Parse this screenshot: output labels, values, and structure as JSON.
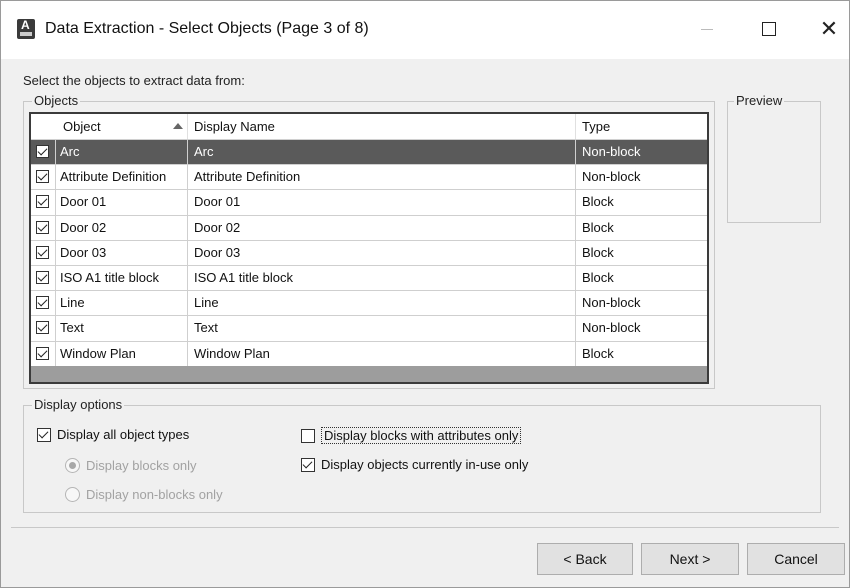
{
  "window": {
    "title": "Data Extraction - Select Objects (Page 3 of 8)",
    "controls": {
      "minimize": "—",
      "maximize": "☐",
      "close": "✕"
    }
  },
  "prompt": "Select the objects to extract data from:",
  "objects_group": {
    "label": "Objects",
    "columns": {
      "object": "Object",
      "display_name": "Display Name",
      "type": "Type"
    },
    "sort_column": "Object",
    "sort_direction": "ascending",
    "rows": [
      {
        "checked": true,
        "object": "Arc",
        "display_name": "Arc",
        "type": "Non-block",
        "selected": true
      },
      {
        "checked": true,
        "object": "Attribute Definition",
        "display_name": "Attribute Definition",
        "type": "Non-block"
      },
      {
        "checked": true,
        "object": "Door 01",
        "display_name": "Door 01",
        "type": "Block"
      },
      {
        "checked": true,
        "object": "Door 02",
        "display_name": "Door 02",
        "type": "Block"
      },
      {
        "checked": true,
        "object": "Door 03",
        "display_name": "Door 03",
        "type": "Block"
      },
      {
        "checked": true,
        "object": "ISO A1 title block",
        "display_name": "ISO A1 title block",
        "type": "Block"
      },
      {
        "checked": true,
        "object": "Line",
        "display_name": "Line",
        "type": "Non-block"
      },
      {
        "checked": true,
        "object": "Text",
        "display_name": "Text",
        "type": "Non-block"
      },
      {
        "checked": true,
        "object": "Window Plan",
        "display_name": "Window Plan",
        "type": "Block"
      }
    ]
  },
  "preview_group": {
    "label": "Preview"
  },
  "display_options": {
    "label": "Display options",
    "display_all_object_types": {
      "label": "Display all object types",
      "checked": true
    },
    "display_blocks_only": {
      "label": "Display blocks only",
      "selected": true,
      "disabled": true
    },
    "display_non_blocks_only": {
      "label": "Display non-blocks only",
      "selected": false,
      "disabled": true
    },
    "display_blocks_with_attributes_only": {
      "label": "Display blocks with attributes only",
      "checked": false
    },
    "display_objects_in_use_only": {
      "label": "Display objects currently in-use only",
      "checked": true
    }
  },
  "buttons": {
    "back": "< Back",
    "next": "Next >",
    "cancel": "Cancel"
  },
  "colors": {
    "selected_row": "#5a5a5a",
    "list_border": "#3b3b3b",
    "dialog_bg": "#f0f0f0",
    "button_bg": "#e1e1e1"
  }
}
